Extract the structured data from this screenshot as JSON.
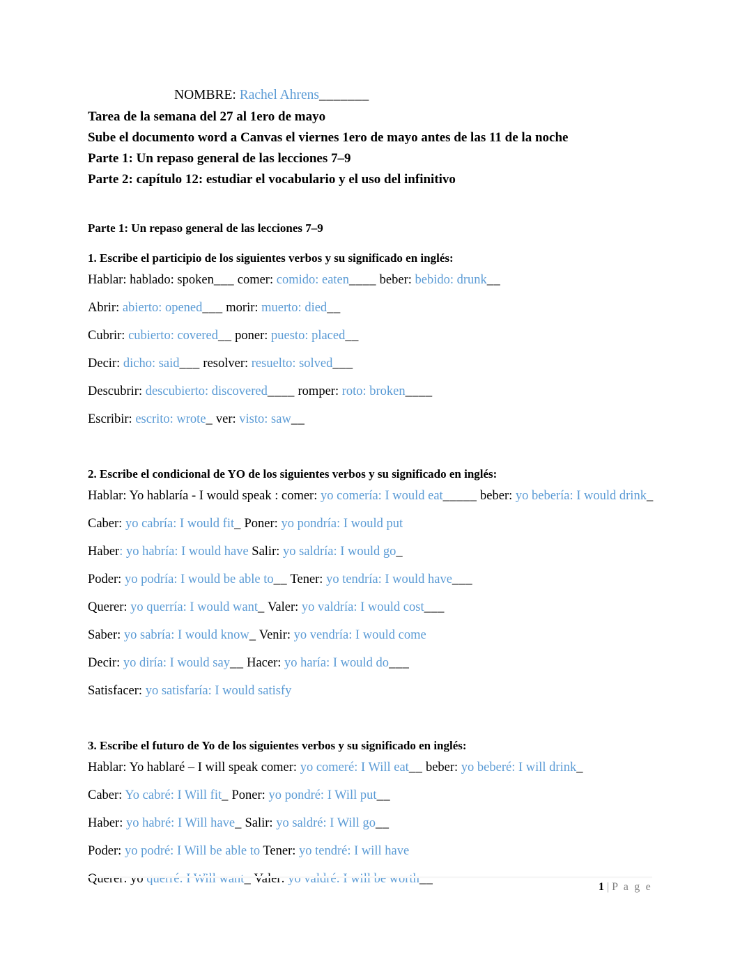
{
  "header": {
    "nombre_label": "NOMBRE:",
    "nombre_value": "Rachel Ahrens",
    "nombre_rule": "_______",
    "lines": [
      "Tarea de la semana del 27 al 1ero de mayo",
      "Sube el documento word a Canvas el viernes 1ero de mayo antes de las 11 de la noche",
      "Parte 1: Un repaso general de las lecciones 7–9",
      "Parte 2: capítulo 12: estudiar el vocabulario y el uso del infinitivo"
    ]
  },
  "part1": {
    "title": "Parte 1: Un repaso general de las lecciones 7–9",
    "q1": {
      "title": "1. Escribe el participio de los siguientes verbos y su significado en inglés:",
      "rows": [
        {
          "a_label": "Hablar:",
          "a_answer": "hablado: spoken",
          "a_answer_color": "black",
          "a_rule": "___",
          "gap": "        ",
          "b_label": "comer:",
          "b_answer": "comido: eaten",
          "b_rule": "____",
          "c_label": "beber:",
          "c_answer": "bebido: drunk",
          "c_rule": "__"
        },
        {
          "a_label": "Abrir:",
          "a_answer": "abierto: opened",
          "a_answer_color": "blue",
          "a_rule": "___",
          "gap": "    ",
          "b_label": "morir:",
          "b_answer": "muerto: died",
          "b_rule": "__"
        },
        {
          "a_label": "Cubrir:",
          "a_answer": "cubierto: covered",
          "a_answer_color": "blue",
          "a_rule": "__",
          "gap": " ",
          "b_label": "poner:",
          "b_answer": "puesto: placed",
          "b_rule": "__"
        },
        {
          "a_label": "Decir:",
          "a_answer": "dicho: said",
          "a_answer_color": "blue",
          "a_rule": "___",
          "gap": "   ",
          "b_label": "resolver:",
          "b_answer": "resuelto: solved",
          "b_rule": "___"
        },
        {
          "a_label": "Descubrir:",
          "a_answer": "descubierto: discovered",
          "a_answer_color": "blue",
          "a_rule": "____",
          "gap": "    ",
          "b_label": "romper:",
          "b_answer": "roto: broken",
          "b_rule": "____"
        },
        {
          "a_label": "Escribir:",
          "a_answer": "escrito: wrote",
          "a_answer_color": "blue",
          "a_rule": "_",
          "gap": "   ",
          "b_label": "ver:",
          "b_answer": "visto: saw",
          "b_rule": "__"
        }
      ]
    },
    "q2": {
      "title": "2. Escribe el condicional de YO de los siguientes verbos y su significado en inglés:",
      "rows": [
        {
          "a_label": "Hablar:",
          "a_answer": "Yo hablaría -  I would speak :",
          "a_answer_color": "black",
          "a_rule": "",
          "gap": "  ",
          "b_label": "comer:",
          "b_answer": "yo comería: I would eat",
          "b_rule": "_____",
          "c_label": "beber:",
          "c_answer": "yo bebería: I would drink",
          "c_rule": "_"
        },
        {
          "a_label": "Caber:",
          "a_answer": "yo cabría: I would fit",
          "a_answer_color": "blue",
          "a_rule": "_",
          "gap": "    ",
          "b_label": "Poner:",
          "b_answer": "yo pondría: I would put",
          "b_rule": ""
        },
        {
          "a_label": "Haber",
          "a_label_colon_blue": true,
          "a_answer": "yo habría: I would have",
          "a_answer_color": "blue",
          "a_rule": "",
          "gap": "    ",
          "b_label": "Salir:",
          "b_answer": "yo saldría: I would go",
          "b_rule": "_"
        },
        {
          "a_label": "Poder:",
          "a_answer": "yo podría: I would be able to",
          "a_answer_color": "blue",
          "a_rule": "__",
          "gap": "    ",
          "b_label": "Tener:",
          "b_answer": "yo tendría: I would have",
          "b_rule": "___"
        },
        {
          "a_label": "Querer:",
          "a_answer": "yo querría: I would want",
          "a_answer_color": "blue",
          "a_rule": "_",
          "gap": "    ",
          "b_label": "Valer:",
          "b_answer": "yo valdría: I would cost",
          "b_rule": "___"
        },
        {
          "a_label": "Saber:",
          "a_answer": "yo sabría: I would know",
          "a_answer_color": "blue",
          "a_rule": "_",
          "gap": "      ",
          "b_label": "Venir:",
          "b_answer": "yo vendría: I would come",
          "b_rule": ""
        },
        {
          "a_label": "Decir:",
          "a_answer": "yo diría: I would say",
          "a_answer_color": "blue",
          "a_rule": "__",
          "gap": "    ",
          "b_label": "Hacer:",
          "b_answer": "yo haría: I would do",
          "b_rule": "___"
        },
        {
          "a_label": "Satisfacer:",
          "a_answer": "yo satisfaría: I would satisfy",
          "a_answer_color": "blue",
          "a_rule": ""
        }
      ]
    },
    "q3": {
      "title": "3. Escribe el futuro de Yo de los siguientes verbos y su significado en inglés:",
      "rows": [
        {
          "a_label": "Hablar:",
          "a_answer": "Yo hablaré – I will speak",
          "a_answer_color": "black",
          "a_rule": "",
          "gap": "    ",
          "b_label": "comer:",
          "b_answer": "yo comeré: I Will eat",
          "b_rule": "__",
          "c_label": "beber:",
          "c_answer": "yo beberé: I will drink",
          "c_rule": "_"
        },
        {
          "a_label": "Caber:",
          "a_answer": "Yo cabré: I Will fit",
          "a_answer_color": "blue",
          "a_rule": "_",
          "gap": "    ",
          "b_label": "Poner:",
          "b_answer": "yo pondré: I Will put",
          "b_rule": "__"
        },
        {
          "a_label": "Haber:",
          "a_answer": "yo habré: I Will have",
          "a_answer_color": "blue",
          "a_rule": "_",
          "gap": "  ",
          "b_label": "Salir:",
          "b_answer": "yo saldré: I Will go",
          "b_rule": "__"
        },
        {
          "a_label": "Poder:",
          "a_answer": "yo podré: I Will be able to",
          "a_answer_color": "blue",
          "a_rule": "",
          "gap": "  ",
          "b_label": "Tener:",
          "b_answer": "yo tendré: I will have",
          "b_rule": ""
        },
        {
          "a_label": "Querer: yo",
          "a_label_plain_prefix": true,
          "a_answer": "querré: I Will want",
          "a_answer_color": "blue",
          "a_rule": "_",
          "gap": "   ",
          "b_label": "Valer:",
          "b_answer": "yo valdré: I will be worth",
          "b_rule": "__"
        }
      ]
    }
  },
  "footer": {
    "page_number": "1",
    "separator": "|",
    "page_word": "P a g e"
  },
  "colors": {
    "answer_blue": "#5B9BD5",
    "text_black": "#000000",
    "footer_gray": "#808080"
  }
}
